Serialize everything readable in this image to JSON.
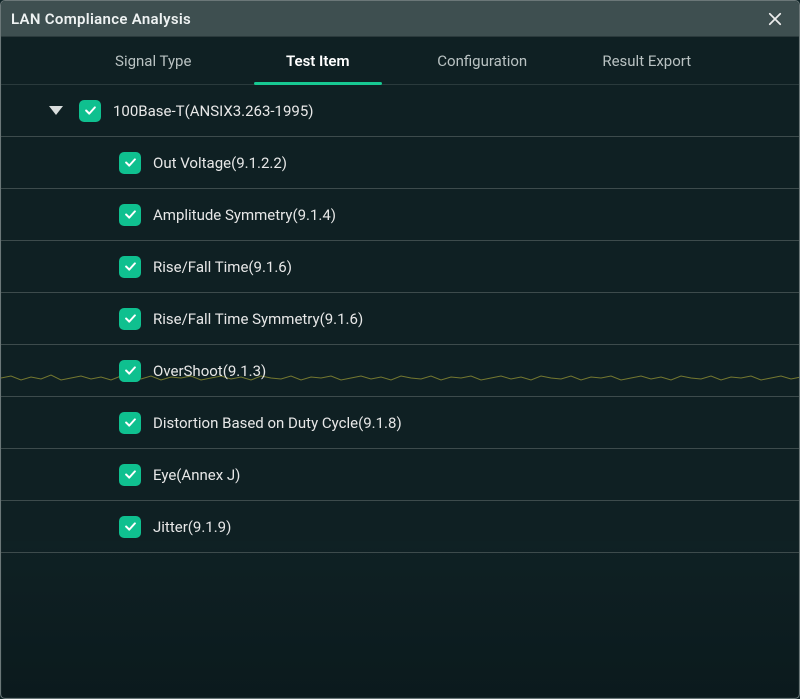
{
  "accent": "#0fc08f",
  "window_title": "LAN Compliance Analysis",
  "tabs": {
    "signal_type": "Signal Type",
    "test_item": "Test Item",
    "configuration": "Configuration",
    "result_export": "Result Export",
    "active": "test_item"
  },
  "tree": {
    "parent": {
      "label": "100Base-T(ANSIX3.263-1995)",
      "checked": true,
      "expanded": true
    },
    "children": [
      {
        "label": "Out Voltage(9.1.2.2)",
        "checked": true
      },
      {
        "label": "Amplitude Symmetry(9.1.4)",
        "checked": true
      },
      {
        "label": "Rise/Fall Time(9.1.6)",
        "checked": true
      },
      {
        "label": "Rise/Fall Time Symmetry(9.1.6)",
        "checked": true
      },
      {
        "label": "OverShoot(9.1.3)",
        "checked": true
      },
      {
        "label": "Distortion Based on Duty Cycle(9.1.8)",
        "checked": true
      },
      {
        "label": "Eye(Annex J)",
        "checked": true
      },
      {
        "label": "Jitter(9.1.9)",
        "checked": true
      }
    ]
  }
}
